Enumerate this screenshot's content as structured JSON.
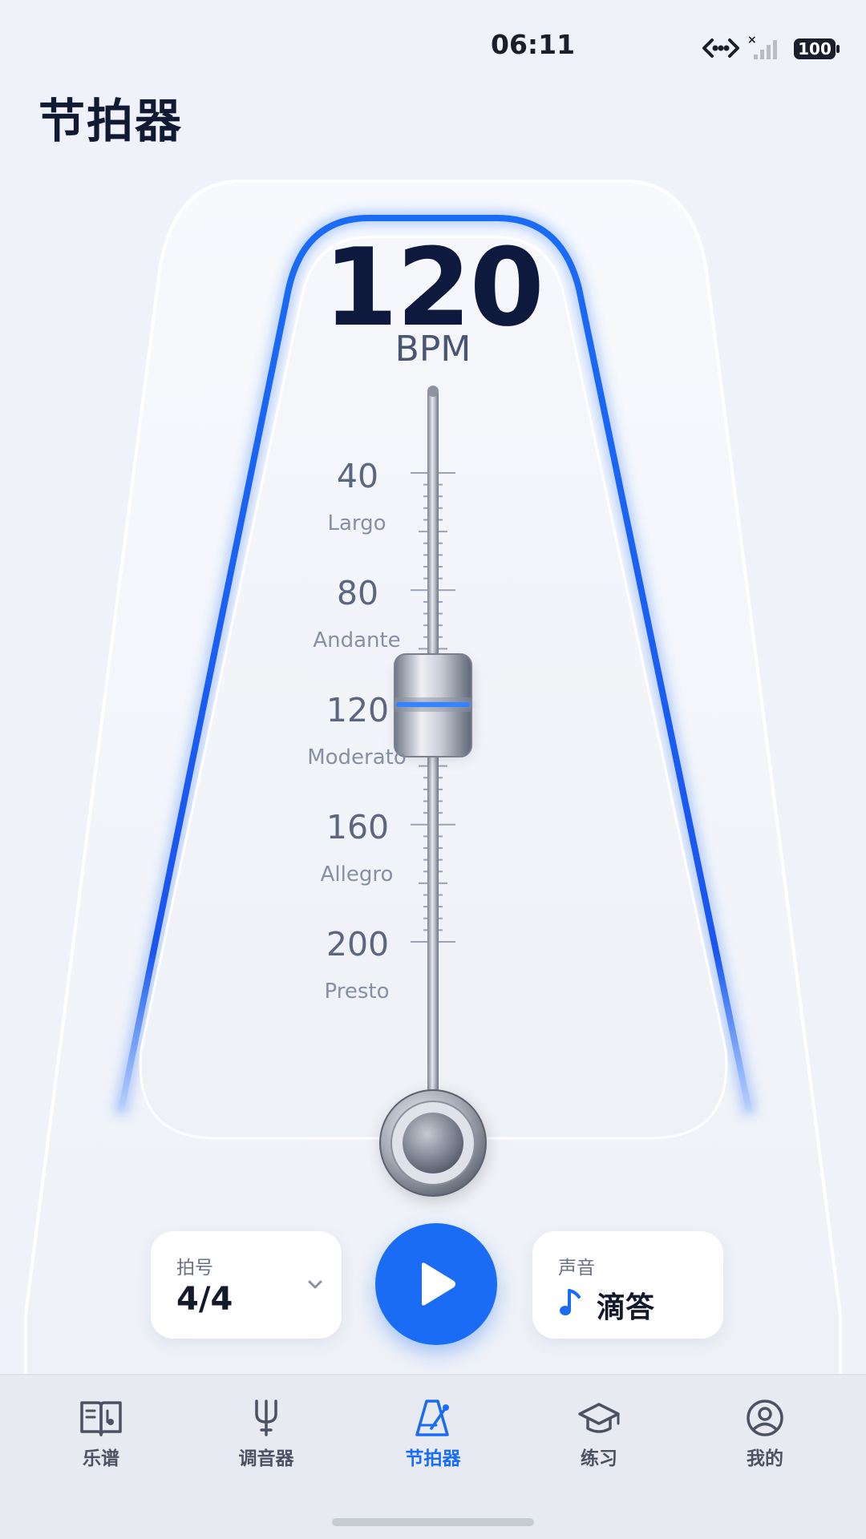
{
  "status_bar": {
    "time": "06:11",
    "battery": "100"
  },
  "header": {
    "title": "节拍器"
  },
  "metronome": {
    "bpm": "120",
    "unit": "BPM",
    "scale": [
      {
        "value": "40",
        "term": "Largo"
      },
      {
        "value": "80",
        "term": "Andante"
      },
      {
        "value": "120",
        "term": "Moderato"
      },
      {
        "value": "160",
        "term": "Allegro"
      },
      {
        "value": "200",
        "term": "Presto"
      }
    ],
    "accent_color": "#1a6cf5"
  },
  "controls": {
    "time_signature": {
      "label": "拍号",
      "value": "4/4"
    },
    "sound": {
      "label": "声音",
      "value": "滴答"
    }
  },
  "tabbar": {
    "items": [
      {
        "label": "乐谱",
        "icon": "score-book-icon"
      },
      {
        "label": "调音器",
        "icon": "tuning-fork-icon"
      },
      {
        "label": "节拍器",
        "icon": "metronome-icon",
        "active": true
      },
      {
        "label": "练习",
        "icon": "graduation-cap-icon"
      },
      {
        "label": "我的",
        "icon": "profile-icon"
      }
    ]
  }
}
